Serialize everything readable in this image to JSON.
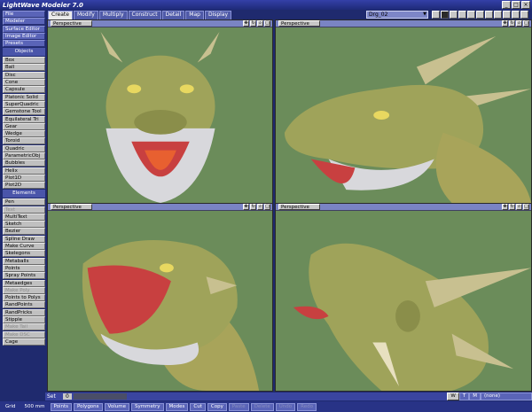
{
  "app": {
    "title": "LightWave Modeler 7.0"
  },
  "tabs": [
    "Create",
    "Modify",
    "Multiply",
    "Construct",
    "Detail",
    "Map",
    "Display"
  ],
  "object_selector": "Drg_02",
  "sidebar": {
    "top": [
      "File",
      "Modeler",
      "Surface Editor",
      "Image Editor",
      "Presets"
    ],
    "objects_header": "Objects",
    "objects": [
      "Box",
      "Ball",
      "Disc",
      "Cone",
      "Capsule",
      "Platonic Solid",
      "SuperQuadric",
      "Gemstone Tool",
      "Equilateral Tri",
      "Gear",
      "Wedge",
      "Toroid",
      "Quadric",
      "ParametricObj",
      "Bubbles",
      "Helix",
      "Plot1D",
      "Plot2D"
    ],
    "elements_header": "Elements",
    "elements": [
      "Pen",
      "Text",
      "MultiText",
      "Sketch",
      "Bezier",
      "Spline Draw",
      "Make Curve",
      "Skelegons",
      "Metaballs",
      "Points",
      "Spray Points",
      "Metaedges",
      "Make Poly",
      "Points to Polys",
      "RandPoints",
      "RandPricks",
      "Stipple",
      "Make Tail",
      "Make DSC",
      "Cage"
    ]
  },
  "viewports": [
    {
      "label": "Perspective"
    },
    {
      "label": "Perspective"
    },
    {
      "label": "Perspective"
    },
    {
      "label": "Perspective"
    }
  ],
  "status": {
    "set_label": "Set",
    "set_value": "0",
    "w": "W",
    "t": "T",
    "m": "M",
    "surface": "(none)"
  },
  "grid": {
    "label": "Grid",
    "value": "500 mm"
  },
  "bottom_buttons": [
    "Points",
    "Polygons",
    "Volume",
    "Symmetry",
    "Modes",
    "Cut",
    "Copy",
    "Paste",
    "Delete",
    "Undo",
    "Redo"
  ],
  "colors": {
    "viewport_bg": "#6b8c5a",
    "dragon_skin": "#9fa35a",
    "mouth": "#c84040",
    "ui_blue": "#1f2a6e"
  }
}
